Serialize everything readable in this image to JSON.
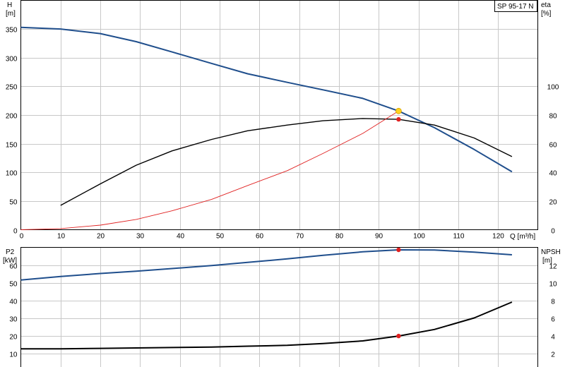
{
  "chart_data": [
    {
      "type": "line",
      "title": "SP 95-17 N",
      "xlabel": "Q [m³/h]",
      "ylabel_left": [
        "H",
        "[m]"
      ],
      "ylabel_right": [
        "eta",
        "[%]"
      ],
      "xlim": [
        0,
        130
      ],
      "ylim_left": [
        0,
        400
      ],
      "ylim_right": [
        0,
        160
      ],
      "x_ticks": [
        0,
        10,
        20,
        30,
        40,
        50,
        60,
        70,
        80,
        90,
        100,
        110,
        120
      ],
      "y_ticks_left": [
        0,
        50,
        100,
        150,
        200,
        250,
        300,
        350
      ],
      "y_ticks_right": [
        0,
        20,
        40,
        60,
        80,
        100
      ],
      "grid": true,
      "series": [
        {
          "axis": "left",
          "color": "#1f4e8c",
          "x": [
            0,
            10,
            20,
            29,
            38,
            48,
            57,
            67,
            76,
            86,
            95,
            104,
            114,
            123.5
          ],
          "y": [
            353,
            350,
            342,
            328,
            310,
            290,
            272,
            257,
            244,
            229,
            207,
            178,
            140,
            101
          ]
        },
        {
          "axis": "right",
          "color": "#000000",
          "x": [
            10,
            20,
            29,
            38,
            48,
            57,
            67,
            76,
            86,
            95,
            104,
            114,
            123.5
          ],
          "y": [
            17,
            32,
            45,
            55,
            63,
            69,
            73,
            76,
            77.6,
            77,
            73,
            64,
            51
          ]
        },
        {
          "axis": "left",
          "color": "#e02020",
          "x": [
            0,
            10,
            20,
            29,
            38,
            48,
            57,
            67,
            76,
            86,
            95
          ],
          "y": [
            0,
            2,
            8,
            18,
            33,
            53,
            77,
            103,
            133,
            168,
            207
          ]
        }
      ],
      "markers": [
        {
          "axis": "left",
          "x": 95,
          "y": 207,
          "color": "#ffd21f"
        },
        {
          "axis": "right",
          "x": 95,
          "y": 77,
          "color": "#e02020"
        }
      ]
    },
    {
      "type": "line",
      "xlabel": "",
      "ylabel_left": [
        "P2",
        "[kW]"
      ],
      "ylabel_right": [
        "NPSH",
        "[m]"
      ],
      "xlim": [
        0,
        130
      ],
      "ylim_left": [
        0,
        70
      ],
      "ylim_right": [
        0,
        14
      ],
      "y_ticks_left": [
        10,
        20,
        30,
        40,
        50,
        60
      ],
      "y_ticks_right": [
        2,
        4,
        6,
        8,
        10,
        12
      ],
      "grid": true,
      "series": [
        {
          "axis": "left",
          "color": "#1f4e8c",
          "x": [
            0,
            10,
            20,
            29,
            38,
            48,
            57,
            67,
            76,
            86,
            95,
            104,
            114,
            123.5
          ],
          "y": [
            51.5,
            53.5,
            55.2,
            56.5,
            58,
            59.7,
            61.5,
            63.5,
            65.5,
            67.5,
            68.6,
            68.5,
            67.3,
            65.8
          ]
        },
        {
          "axis": "right",
          "color": "#000000",
          "x": [
            0,
            10,
            20,
            29,
            38,
            48,
            57,
            67,
            76,
            86,
            95,
            104,
            114,
            123.5
          ],
          "y": [
            2.5,
            2.5,
            2.55,
            2.6,
            2.65,
            2.7,
            2.8,
            2.9,
            3.1,
            3.4,
            3.95,
            4.7,
            6.0,
            7.8
          ]
        }
      ],
      "markers": [
        {
          "axis": "left",
          "x": 95,
          "y": 68.6,
          "color": "#e02020"
        },
        {
          "axis": "right",
          "x": 95,
          "y": 3.95,
          "color": "#e02020"
        }
      ]
    }
  ]
}
